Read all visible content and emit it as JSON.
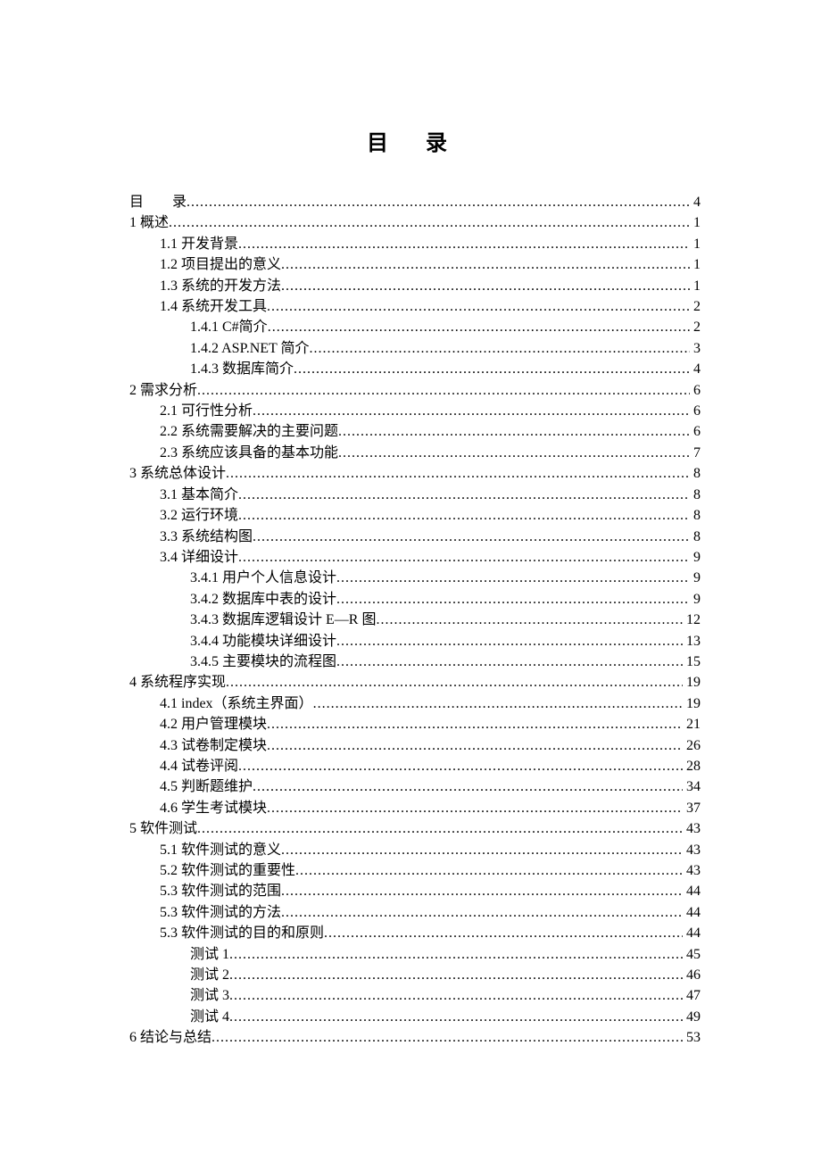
{
  "title": "目 录",
  "entries": [
    {
      "level": 0,
      "label": "目　　录",
      "page": "4",
      "first": true
    },
    {
      "level": 0,
      "label": "1 概述",
      "page": "1"
    },
    {
      "level": 1,
      "label": "1.1 开发背景",
      "page": "1"
    },
    {
      "level": 1,
      "label": "1.2 项目提出的意义",
      "page": "1"
    },
    {
      "level": 1,
      "label": "1.3 系统的开发方法",
      "page": "1"
    },
    {
      "level": 1,
      "label": "1.4 系统开发工具",
      "page": "2"
    },
    {
      "level": 2,
      "label": "1.4.1 C#简介",
      "page": "2"
    },
    {
      "level": 2,
      "label": "1.4.2 ASP.NET 简介",
      "page": "3"
    },
    {
      "level": 2,
      "label": "1.4.3 数据库简介",
      "page": "4"
    },
    {
      "level": 0,
      "label": "2 需求分析",
      "page": "6"
    },
    {
      "level": 1,
      "label": "2.1 可行性分析",
      "page": "6"
    },
    {
      "level": 1,
      "label": "2.2 系统需要解决的主要问题",
      "page": "6"
    },
    {
      "level": 1,
      "label": "2.3 系统应该具备的基本功能",
      "page": "7"
    },
    {
      "level": 0,
      "label": "3 系统总体设计",
      "page": "8"
    },
    {
      "level": 1,
      "label": "3.1 基本简介",
      "page": "8"
    },
    {
      "level": 1,
      "label": "3.2 运行环境",
      "page": "8"
    },
    {
      "level": 1,
      "label": "3.3 系统结构图",
      "page": "8"
    },
    {
      "level": 1,
      "label": "3.4 详细设计",
      "page": "9"
    },
    {
      "level": 2,
      "label": "3.4.1 用户个人信息设计",
      "page": "9"
    },
    {
      "level": 2,
      "label": "3.4.2 数据库中表的设计",
      "page": "9"
    },
    {
      "level": 2,
      "label": "3.4.3 数据库逻辑设计 E—R 图",
      "page": "12"
    },
    {
      "level": 2,
      "label": "3.4.4 功能模块详细设计",
      "page": "13"
    },
    {
      "level": 2,
      "label": "3.4.5 主要模块的流程图",
      "page": "15"
    },
    {
      "level": 0,
      "label": "4 系统程序实现",
      "page": "19"
    },
    {
      "level": 1,
      "label": "4.1 index（系统主界面）",
      "page": "19"
    },
    {
      "level": 1,
      "label": "4.2 用户管理模块",
      "page": "21"
    },
    {
      "level": 1,
      "label": "4.3 试卷制定模块",
      "page": "26"
    },
    {
      "level": 1,
      "label": "4.4 试卷评阅",
      "page": "28"
    },
    {
      "level": 1,
      "label": "4.5 判断题维护",
      "page": "34"
    },
    {
      "level": 1,
      "label": "4.6 学生考试模块",
      "page": "37"
    },
    {
      "level": 0,
      "label": "5 软件测试",
      "page": "43"
    },
    {
      "level": 1,
      "label": "5.1 软件测试的意义",
      "page": "43"
    },
    {
      "level": 1,
      "label": "5.2 软件测试的重要性",
      "page": "43"
    },
    {
      "level": 1,
      "label": "5.3 软件测试的范围",
      "page": "44"
    },
    {
      "level": 1,
      "label": "5.3 软件测试的方法",
      "page": "44"
    },
    {
      "level": 1,
      "label": "5.3 软件测试的目的和原则",
      "page": "44"
    },
    {
      "level": 2,
      "label": "测试 1",
      "page": "45"
    },
    {
      "level": 2,
      "label": "测试 2",
      "page": "46"
    },
    {
      "level": 2,
      "label": "测试 3",
      "page": "47"
    },
    {
      "level": 2,
      "label": "测试 4",
      "page": "49"
    },
    {
      "level": 0,
      "label": "6 结论与总结",
      "page": "53"
    }
  ]
}
